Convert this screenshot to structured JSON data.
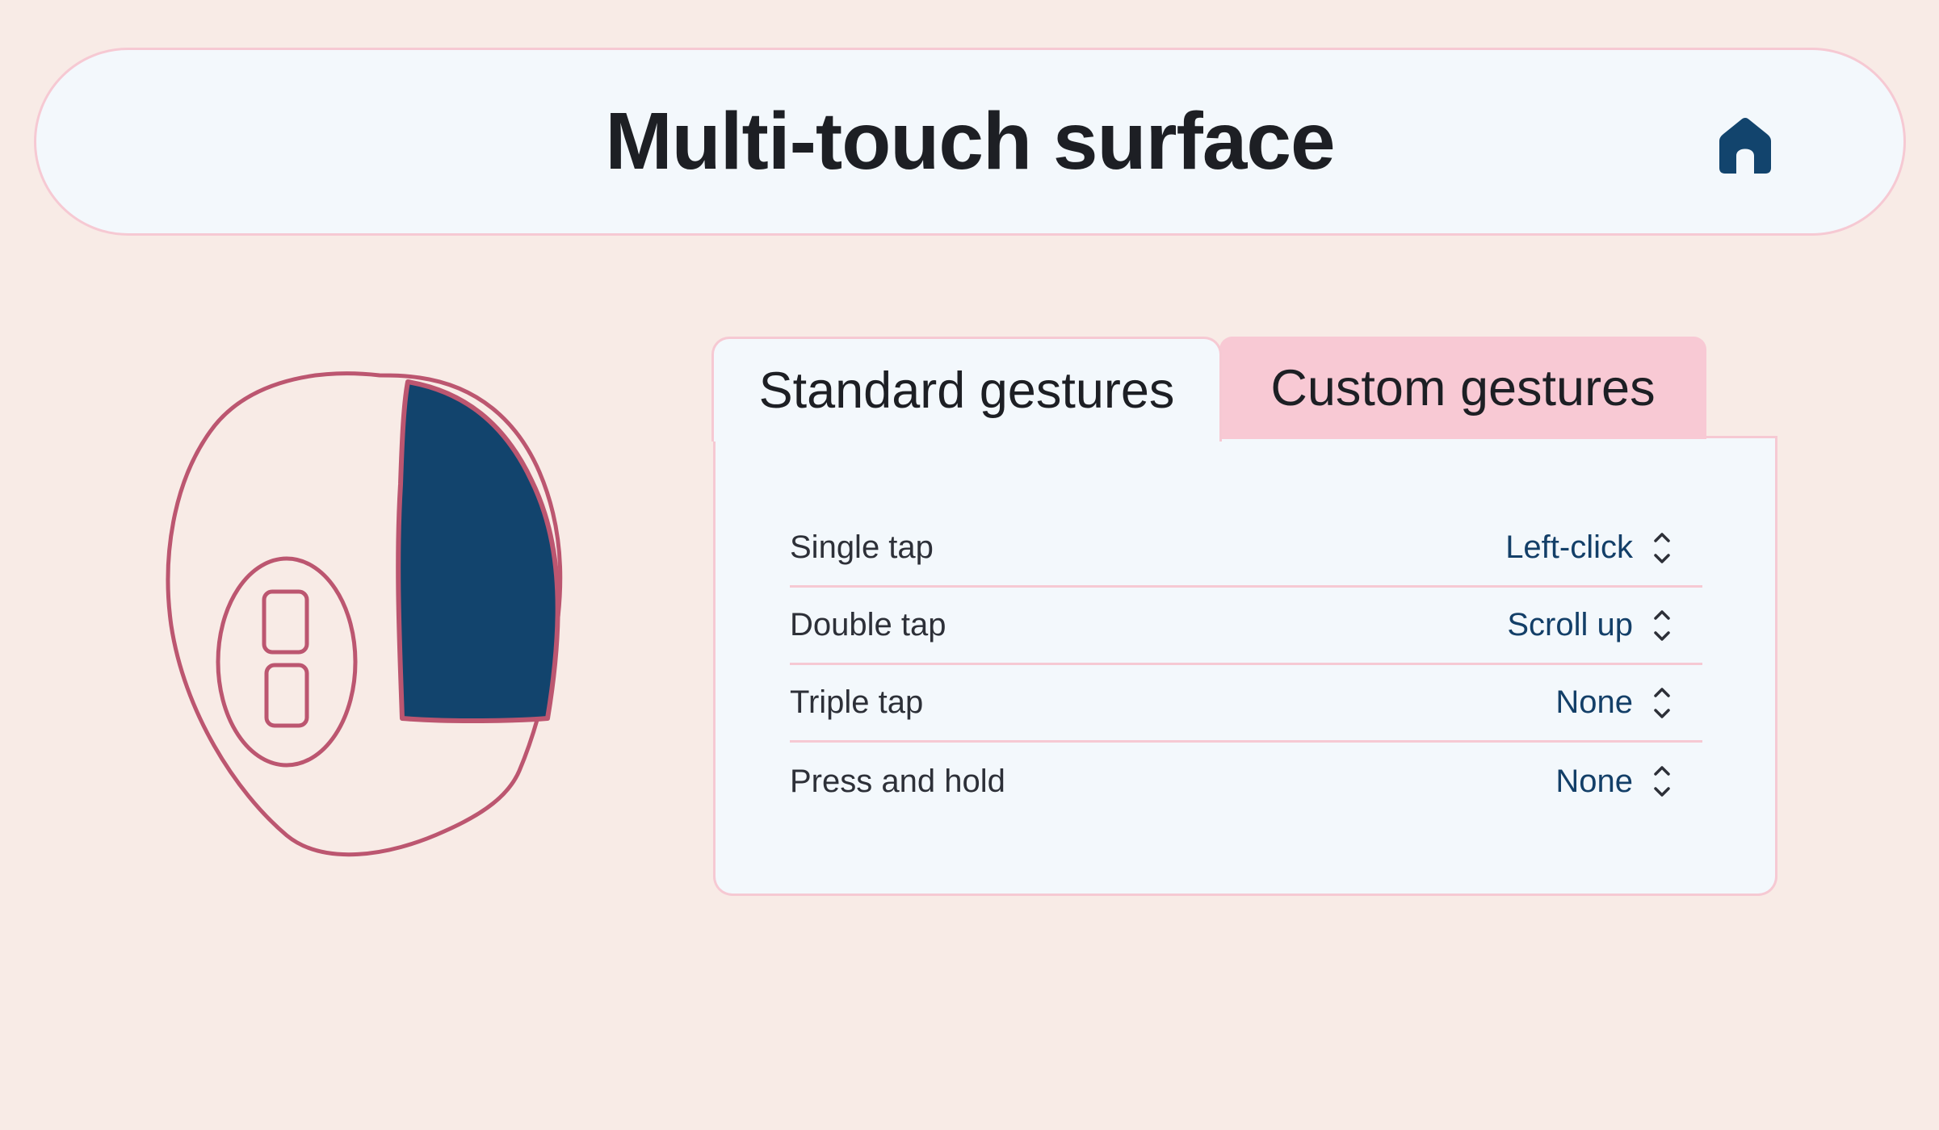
{
  "header": {
    "title": "Multi-touch surface",
    "home_icon": "home-icon"
  },
  "colors": {
    "background": "#f8ebe6",
    "accent_pink": "#f8c9d4",
    "border_pink": "#f6c9d3",
    "navy": "#12446d",
    "outline_red": "#bc5670",
    "panel_bg": "#f3f8fc"
  },
  "illustration": {
    "name": "mouse-touch-surface-illustration"
  },
  "tabs": [
    {
      "label": "Standard gestures",
      "active": true
    },
    {
      "label": "Custom gestures",
      "active": false
    }
  ],
  "gestures": [
    {
      "label": "Single tap",
      "value": "Left-click"
    },
    {
      "label": "Double tap",
      "value": "Scroll up"
    },
    {
      "label": "Triple tap",
      "value": "None"
    },
    {
      "label": "Press and hold",
      "value": "None"
    }
  ]
}
